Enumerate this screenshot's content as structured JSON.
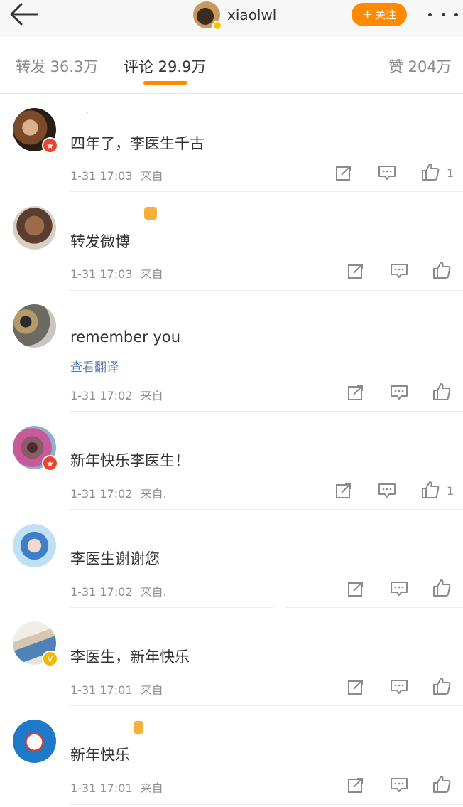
{
  "header": {
    "back_icon": "arrow-left-icon",
    "author_name": "xiaolwl",
    "follow_label": "关注",
    "follow_icon": "plus-icon",
    "more_icon": "more-dots-icon",
    "accent": "#ff8a00"
  },
  "tabs": [
    {
      "label": "转发 36.3万",
      "active": false
    },
    {
      "label": "评论 29.9万",
      "active": true
    },
    {
      "label": "赞 204万",
      "active": false
    }
  ],
  "comments": [
    {
      "text": "四年了，李医生千古",
      "time": "1-31 17:03",
      "source": "来自",
      "likes": "1",
      "badge": "red",
      "translate": ""
    },
    {
      "text": "转发微博",
      "time": "1-31 17:03",
      "source": "来自",
      "likes": "",
      "badge": "",
      "translate": ""
    },
    {
      "text": "remember you",
      "time": "1-31 17:02",
      "source": "来自",
      "likes": "",
      "badge": "",
      "translate": "查看翻译"
    },
    {
      "text": "新年快乐李医生！",
      "time": "1-31 17:02",
      "source": "来自.",
      "likes": "1",
      "badge": "red",
      "translate": ""
    },
    {
      "text": "李医生谢谢您",
      "time": "1-31 17:02",
      "source": "来自.",
      "likes": "",
      "badge": "",
      "translate": ""
    },
    {
      "text": "李医生，新年快乐",
      "time": "1-31 17:01",
      "source": "来自",
      "likes": "",
      "badge": "gold",
      "translate": ""
    },
    {
      "text": "新年快乐",
      "time": "1-31 17:01",
      "source": "来自",
      "likes": "",
      "badge": "",
      "translate": ""
    }
  ],
  "colors": {
    "link": "#5b7da6",
    "meta": "#8f8f8f",
    "badge_red": "#e6472c",
    "badge_gold": "#f5b800"
  }
}
